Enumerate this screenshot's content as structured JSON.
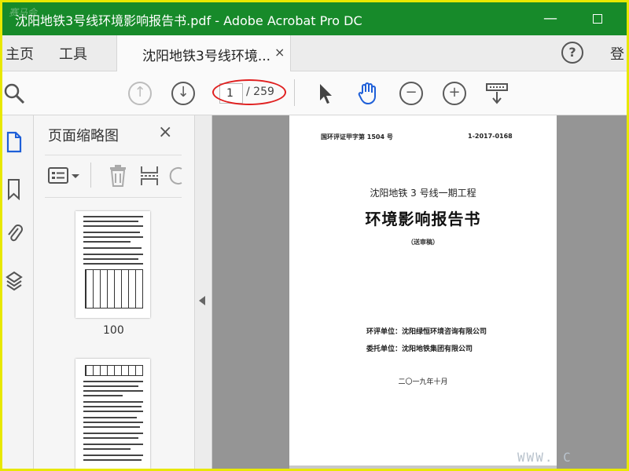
{
  "window": {
    "title": "沈阳地铁3号线环境影响报告书.pdf - Adobe Acrobat Pro DC",
    "watermark": "赛马会",
    "minimize_label": "—",
    "maximize_icon": "maximize-icon"
  },
  "tabs": {
    "home": "主页",
    "tools": "工具",
    "document": "沈阳地铁3号线环境...",
    "close": "×",
    "help": "?",
    "login": "登"
  },
  "toolbar": {
    "current_page": "1",
    "total_pages": "/ 259",
    "highlight_color": "#e02020"
  },
  "thumbnail_panel": {
    "title": "页面缩略图",
    "close": "×",
    "thumbnails": [
      {
        "label": "100"
      },
      {
        "label": ""
      }
    ]
  },
  "document_page": {
    "header_left": "国环评证甲字第 1504 号",
    "header_right": "1-2017-0168",
    "project": "沈阳地铁 3 号线一期工程",
    "title": "环境影响报告书",
    "note": "（送审稿）",
    "eia_unit": "环评单位：沈阳绿恒环境咨询有限公司",
    "client_unit": "委托单位：沈阳地铁集团有限公司",
    "date": "二〇一九年十月"
  },
  "overlay": {
    "watermark": "WWW. C"
  },
  "colors": {
    "titlebar": "#178a2a",
    "frame": "#e8e800",
    "docview": "#959595"
  }
}
